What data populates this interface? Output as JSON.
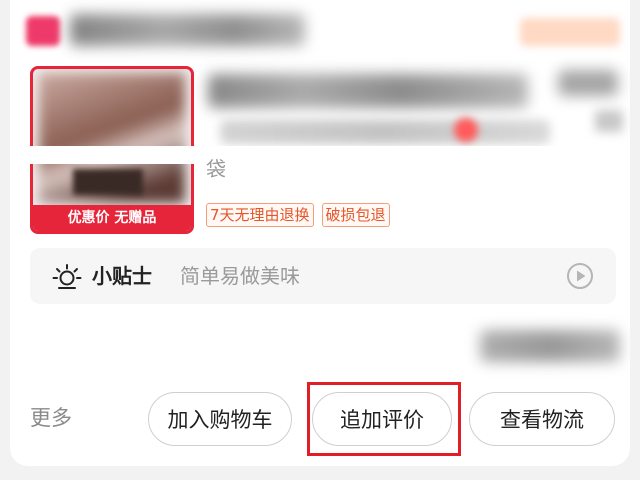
{
  "product": {
    "promo_label": "优惠价 无赠品",
    "spec_tail": "袋",
    "service_tags": [
      "7天无理由退换",
      "破损包退"
    ]
  },
  "tip": {
    "title": "小贴士",
    "text": "简单易做美味"
  },
  "actions": {
    "more_label": "更多",
    "add_to_cart_label": "加入购物车",
    "add_review_label": "追加评价",
    "view_logistics_label": "查看物流"
  },
  "colors": {
    "accent_red": "#e6253b",
    "highlight_red": "#e01e26",
    "tag_orange": "#e5572b"
  },
  "icons": {
    "tip": "light-bulb-icon",
    "play": "play-icon"
  }
}
